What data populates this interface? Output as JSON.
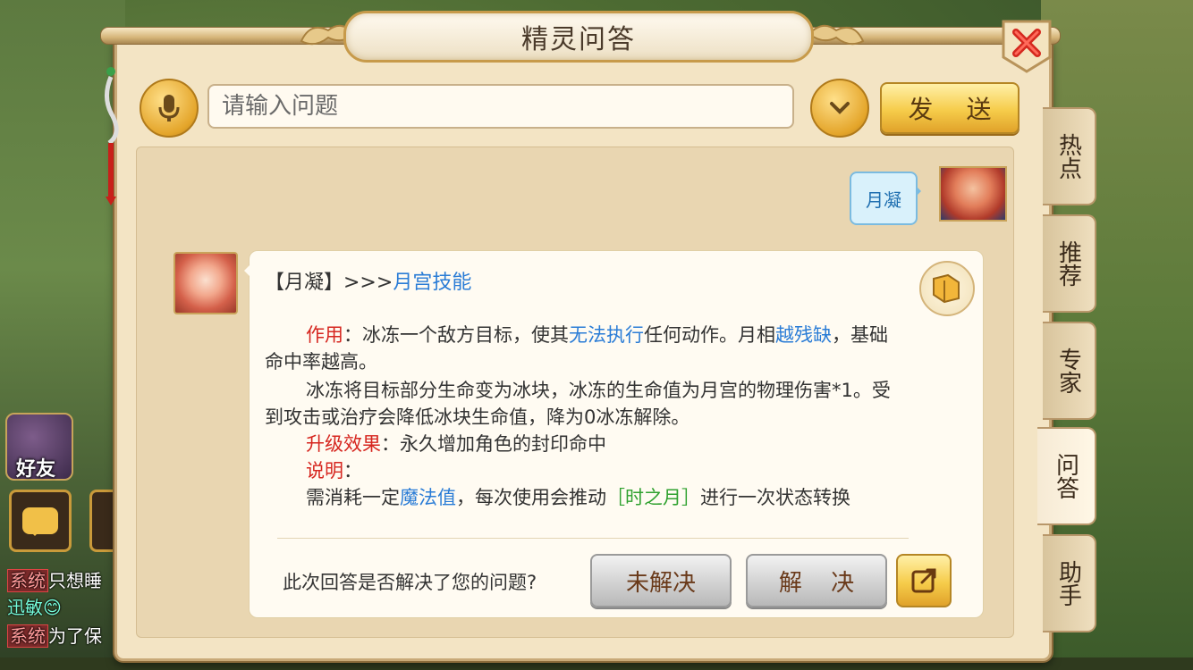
{
  "dialog": {
    "title": "精灵问答"
  },
  "search": {
    "placeholder": "请输入问题",
    "send_label": "发 送"
  },
  "side_tabs": [
    {
      "label": "热点",
      "active": false
    },
    {
      "label": "推荐",
      "active": false
    },
    {
      "label": "专家",
      "active": false
    },
    {
      "label": "问答",
      "active": true
    },
    {
      "label": "助手",
      "active": false
    }
  ],
  "user_message": {
    "text": "月凝"
  },
  "answer": {
    "header_prefix": "【月凝】>>>",
    "header_link": "月宫技能",
    "effect_label": "作用",
    "effect_text_1": "：冰冻一个敌方目标，使其",
    "effect_highlight_1": "无法执行",
    "effect_text_2": "任何动作。月相",
    "effect_highlight_2": "越残缺",
    "effect_text_3": "，基础",
    "effect_line2": "命中率越高。",
    "ice_line1": "冰冻将目标部分生命变为冰块，冰冻的生命值为月宫的物理伤害*1。受",
    "ice_line2": "到攻击或治疗会降低冰块生命值，降为0冰冻解除。",
    "upgrade_label": "升级效果",
    "upgrade_text": "：永久增加角色的封印命中",
    "note_label": "说明",
    "note_colon": "：",
    "note_text_1": "需消耗一定",
    "note_highlight": "魔法值",
    "note_text_2": "，每次使用会推动",
    "note_green": "［时之月］",
    "note_text_3": "进行一次状态转换"
  },
  "feedback": {
    "question": "此次回答是否解决了您的问题?",
    "unresolved_label": "未解决",
    "resolved_label": "解 决"
  },
  "hud": {
    "friends_label": "好友",
    "chat_lines": [
      {
        "tag": "系统",
        "text": "只想睡"
      },
      {
        "tag": "",
        "text": "迅敏😊"
      },
      {
        "tag": "系统",
        "text": "为了保"
      }
    ]
  },
  "colors": {
    "panel_bg": "#f3e4c4",
    "highlight_red": "#d6261f",
    "highlight_blue": "#2a7cd6",
    "highlight_green": "#2fa12f",
    "gold_button": "#f6cc4a"
  }
}
